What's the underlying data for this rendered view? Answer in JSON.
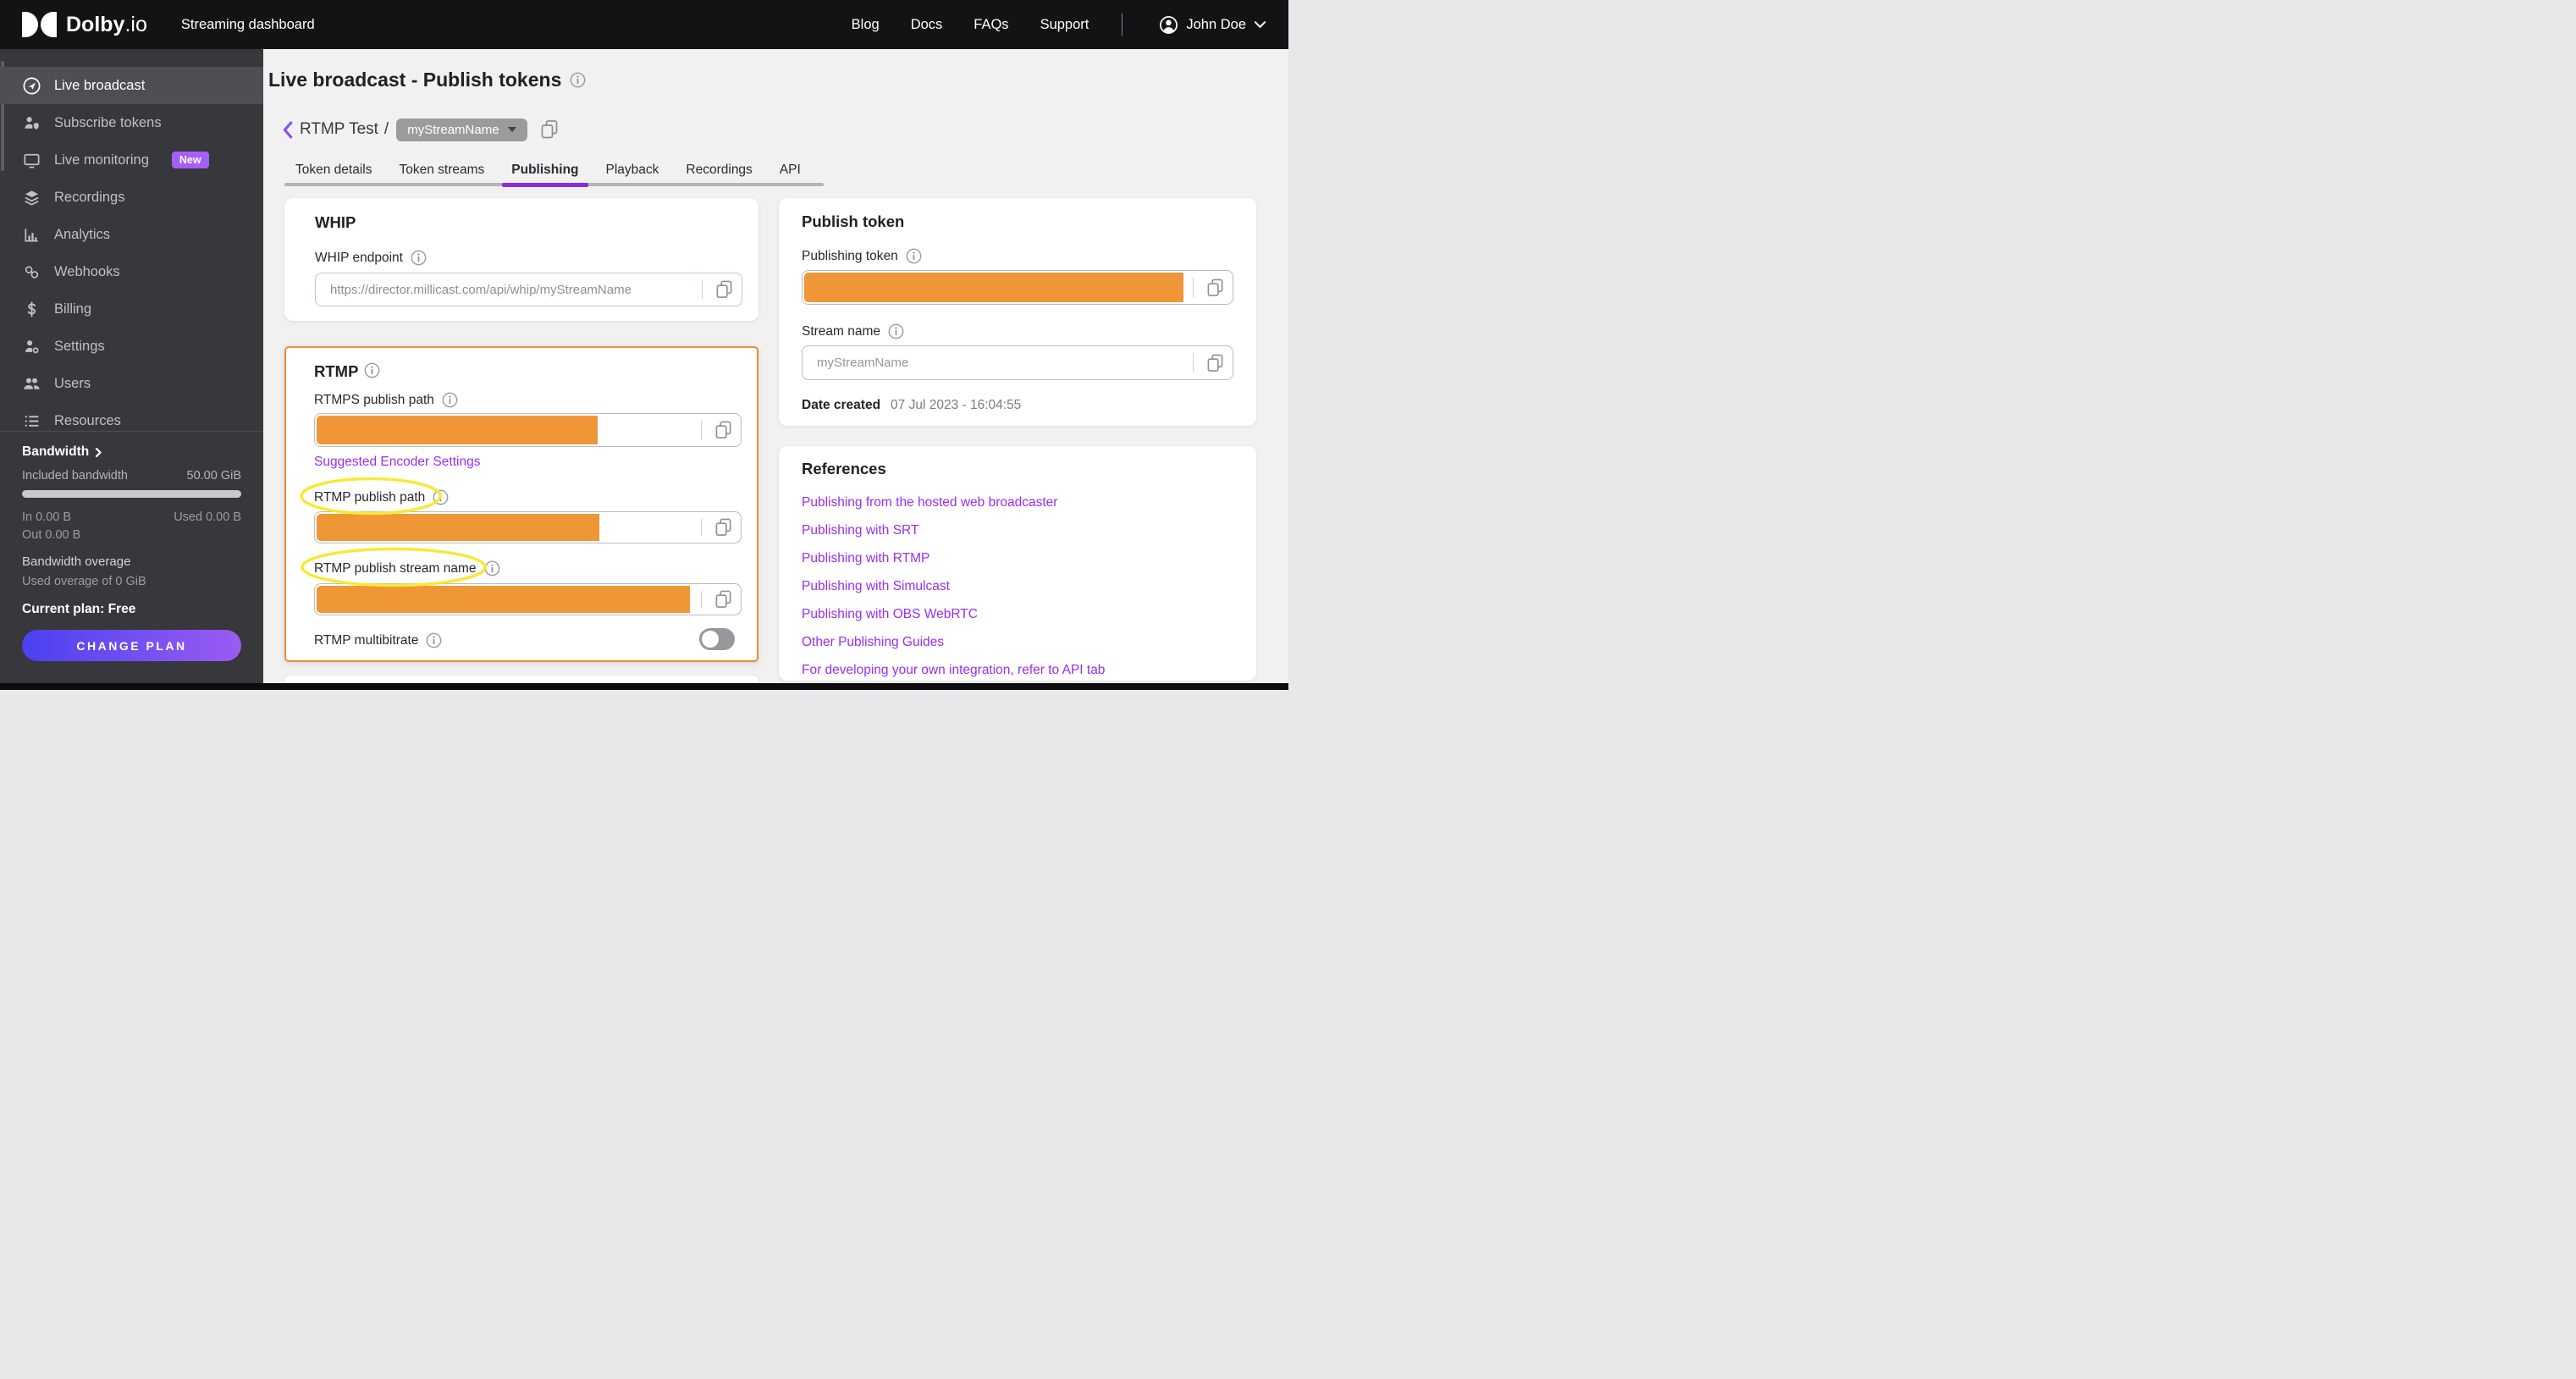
{
  "topbar": {
    "brand_bold": "Dolby",
    "brand_light": ".io",
    "product": "Streaming dashboard",
    "nav": [
      "Blog",
      "Docs",
      "FAQs",
      "Support"
    ],
    "user_name": "John Doe"
  },
  "sidebar": {
    "items": [
      {
        "label": "Live broadcast",
        "icon": "broadcast-icon",
        "active": true
      },
      {
        "label": "Subscribe tokens",
        "icon": "subscribe-tokens-icon"
      },
      {
        "label": "Live monitoring",
        "icon": "live-monitoring-icon",
        "badge": "New"
      },
      {
        "label": "Recordings",
        "icon": "recordings-icon"
      },
      {
        "label": "Analytics",
        "icon": "analytics-icon"
      },
      {
        "label": "Webhooks",
        "icon": "webhooks-icon"
      },
      {
        "label": "Billing",
        "icon": "billing-icon"
      },
      {
        "label": "Settings",
        "icon": "settings-icon"
      },
      {
        "label": "Users",
        "icon": "users-icon"
      },
      {
        "label": "Resources",
        "icon": "resources-icon"
      }
    ],
    "bandwidth": {
      "title": "Bandwidth",
      "included_label": "Included bandwidth",
      "included_value": "50.00 GiB",
      "in_value": "In 0.00 B",
      "used_value": "Used 0.00 B",
      "out_value": "Out 0.00 B",
      "overage_title": "Bandwidth overage",
      "overage_detail": "Used overage of 0 GiB",
      "plan": "Current plan: Free",
      "cta": "CHANGE PLAN"
    }
  },
  "page": {
    "title": "Live broadcast - Publish tokens",
    "breadcrumb": {
      "token": "RTMP Test",
      "separator": "/",
      "stream": "myStreamName"
    },
    "tabs": [
      "Token details",
      "Token streams",
      "Publishing",
      "Playback",
      "Recordings",
      "API"
    ],
    "active_tab": "Publishing"
  },
  "whip": {
    "title": "WHIP",
    "endpoint_label": "WHIP endpoint",
    "endpoint_value": "https://director.millicast.com/api/whip/myStreamName"
  },
  "rtmp": {
    "title": "RTMP",
    "rtmps_path_label": "RTMPS publish path",
    "encoder_link": "Suggested Encoder Settings",
    "rtmp_path_label": "RTMP publish path",
    "rtmp_stream_label": "RTMP publish stream name",
    "multibitrate_label": "RTMP multibitrate",
    "multibitrate_enabled": false
  },
  "publish_token": {
    "title": "Publish token",
    "token_label": "Publishing token",
    "stream_label": "Stream name",
    "stream_value": "myStreamName",
    "date_label": "Date created",
    "date_value": "07 Jul 2023 - 16:04:55"
  },
  "references": {
    "title": "References",
    "links": [
      "Publishing from the hosted web broadcaster",
      "Publishing with SRT",
      "Publishing with RTMP",
      "Publishing with Simulcast",
      "Publishing with OBS WebRTC",
      "Other Publishing Guides",
      "For developing your own integration, refer to API tab"
    ]
  },
  "colors": {
    "accent_purple": "#8a2be2",
    "link_purple": "#9a2df0",
    "badge_purple": "#a55ef7",
    "redaction_orange": "#ef9637",
    "card_border_orange": "#ee8c2f",
    "annotation_yellow": "#f6e92e",
    "cta_gradient_from": "#4a41ef",
    "cta_gradient_to": "#9a5cf3"
  }
}
